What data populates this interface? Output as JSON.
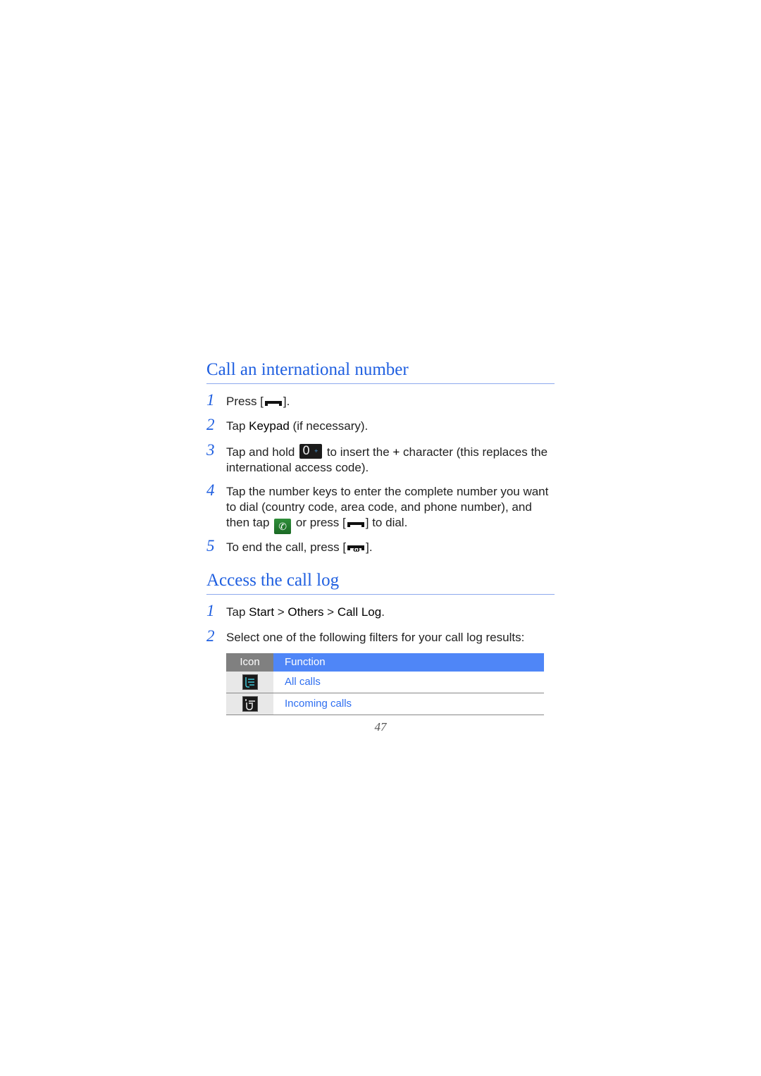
{
  "sections": [
    {
      "title": "Call an international number",
      "steps": [
        {
          "num": "1",
          "pre": "Press [",
          "post": "]."
        },
        {
          "num": "2",
          "pre": "Tap ",
          "bold": "Keypad",
          "post": " (if necessary)."
        },
        {
          "num": "3",
          "pre": "Tap and hold ",
          "post": " to insert the ",
          "bold": "+",
          "post2": " character (this replaces the international access code)."
        },
        {
          "num": "4",
          "text": "Tap the number keys to enter the complete number you want to dial (country code, area code, and phone number), and then tap ",
          "mid": " or press [",
          "post": "] to dial."
        },
        {
          "num": "5",
          "pre": "To end the call, press [",
          "post": "]."
        }
      ]
    },
    {
      "title": "Access the call log",
      "steps": [
        {
          "num": "1",
          "pre": "Tap ",
          "b1": "Start",
          "sep1": " > ",
          "b2": "Others",
          "sep2": " > ",
          "b3": "Call Log",
          "post": "."
        },
        {
          "num": "2",
          "text": "Select one of the following filters for your call log results:"
        }
      ]
    }
  ],
  "icons": {
    "send_key": "send-key-icon",
    "zero_key": "zero-plus-key-icon",
    "zero_label": "0",
    "plus_label": "+",
    "call_button": "green-call-icon",
    "end_key": "end-key-icon"
  },
  "table": {
    "headers": [
      "Icon",
      "Function"
    ],
    "rows": [
      {
        "icon": "all-calls-icon",
        "function": "All calls"
      },
      {
        "icon": "incoming-calls-icon",
        "function": "Incoming calls"
      }
    ]
  },
  "page_number": "47",
  "colors": {
    "heading": "#1f5fe0",
    "table_header_icon": "#808080",
    "table_header_function": "#4f86f7",
    "link_text": "#2f6ff0"
  }
}
